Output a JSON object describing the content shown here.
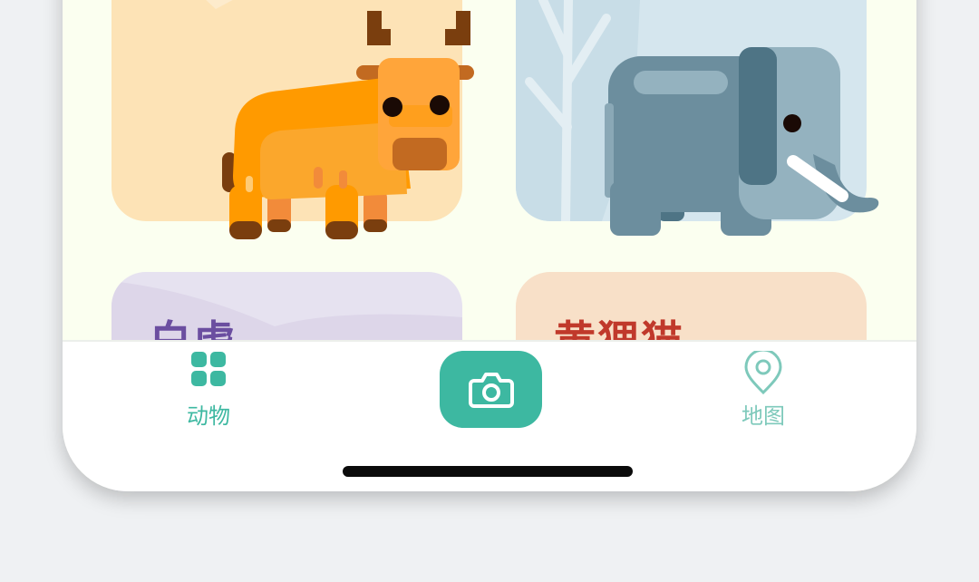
{
  "cards": [
    {
      "name": "cow",
      "bg": "#fde3b6",
      "accent": "#f7a21a"
    },
    {
      "name": "elephant",
      "bg": "#d5e6ee",
      "accent": "#6c8e9e"
    },
    {
      "name": "baihu",
      "title": "白虎",
      "bg": "#e6e2f0",
      "title_color": "#6b4ea0"
    },
    {
      "name": "huanglimao",
      "title": "黄狸猫",
      "bg": "#f8e0c8",
      "title_color": "#c0392b"
    }
  ],
  "tabbar": {
    "tabs": [
      {
        "label": "动物",
        "icon": "grid-icon",
        "color": "#3db8a1",
        "active": true
      },
      {
        "label": "地图",
        "icon": "map-pin-icon",
        "color": "#7ec9bb",
        "active": false
      }
    ],
    "camera": {
      "icon": "camera-icon",
      "color": "#3db8a1"
    }
  }
}
